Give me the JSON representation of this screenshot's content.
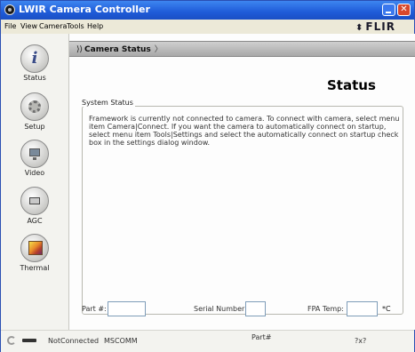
{
  "window": {
    "title": "LWIR Camera Controller"
  },
  "menu": {
    "items": [
      "File",
      "View",
      "Camera",
      "Tools",
      "Help"
    ],
    "brand": "FLIR"
  },
  "sidebar": {
    "items": [
      {
        "label": "Status",
        "icon": "info-icon"
      },
      {
        "label": "Setup",
        "icon": "gear-icon"
      },
      {
        "label": "Video",
        "icon": "monitor-icon"
      },
      {
        "label": "AGC",
        "icon": "agc-icon"
      },
      {
        "label": "Thermal",
        "icon": "thermal-icon"
      }
    ]
  },
  "breadcrumb": {
    "current": "Camera Status"
  },
  "page": {
    "title": "Status"
  },
  "system_status": {
    "legend": "System Status",
    "message": "Framework is currently not connected to camera. To connect with camera, select menu item Camera|Connect. If you want the camera to automatically connect on startup, select menu item Tools|Settings and select the automatically connect on startup check box in the settings dialog window."
  },
  "fields": {
    "part_label": "Part #:",
    "part_value": "",
    "serial_label": "Serial Number:",
    "serial_value": "",
    "fpa_label": "FPA Temp:",
    "fpa_value": "",
    "fpa_unit": "*C"
  },
  "statusbar": {
    "connection": "NotConnected",
    "protocol": "MSCOMM",
    "part": "Part#",
    "extra": "?x?"
  }
}
